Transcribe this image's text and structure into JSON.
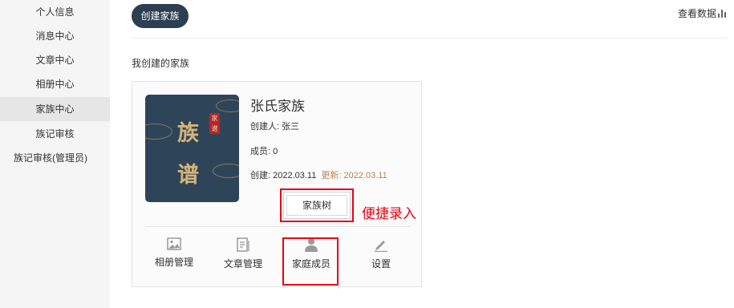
{
  "sidebar": {
    "items": [
      {
        "label": "个人信息",
        "active": false
      },
      {
        "label": "消息中心",
        "active": false
      },
      {
        "label": "文章中心",
        "active": false
      },
      {
        "label": "相册中心",
        "active": false
      },
      {
        "label": "家族中心",
        "active": true
      },
      {
        "label": "族记审核",
        "active": false
      },
      {
        "label": "族记审核(管理员)",
        "active": false
      }
    ]
  },
  "header": {
    "create_label": "创建家族",
    "view_data_label": "查看数据"
  },
  "section_title": "我创建的家族",
  "family": {
    "cover": {
      "char1": "族",
      "char2": "谱",
      "seal": "家谱"
    },
    "name": "张氏家族",
    "creator": "创建人: 张三",
    "members": "成员: 0",
    "created": "创建: 2022.03.11",
    "updated": "更新: 2022.03.11",
    "tree_label": "家族树",
    "annotation": "便捷录入",
    "actions": [
      {
        "label": "相册管理",
        "icon": "image-icon"
      },
      {
        "label": "文章管理",
        "icon": "document-icon"
      },
      {
        "label": "家庭成员",
        "icon": "person-icon"
      },
      {
        "label": "设置",
        "icon": "pencil-icon"
      }
    ]
  },
  "colors": {
    "primary": "#2c3e50",
    "highlight": "#e60012",
    "updated_text": "#b08a56",
    "cover_bg": "#2e4459"
  }
}
